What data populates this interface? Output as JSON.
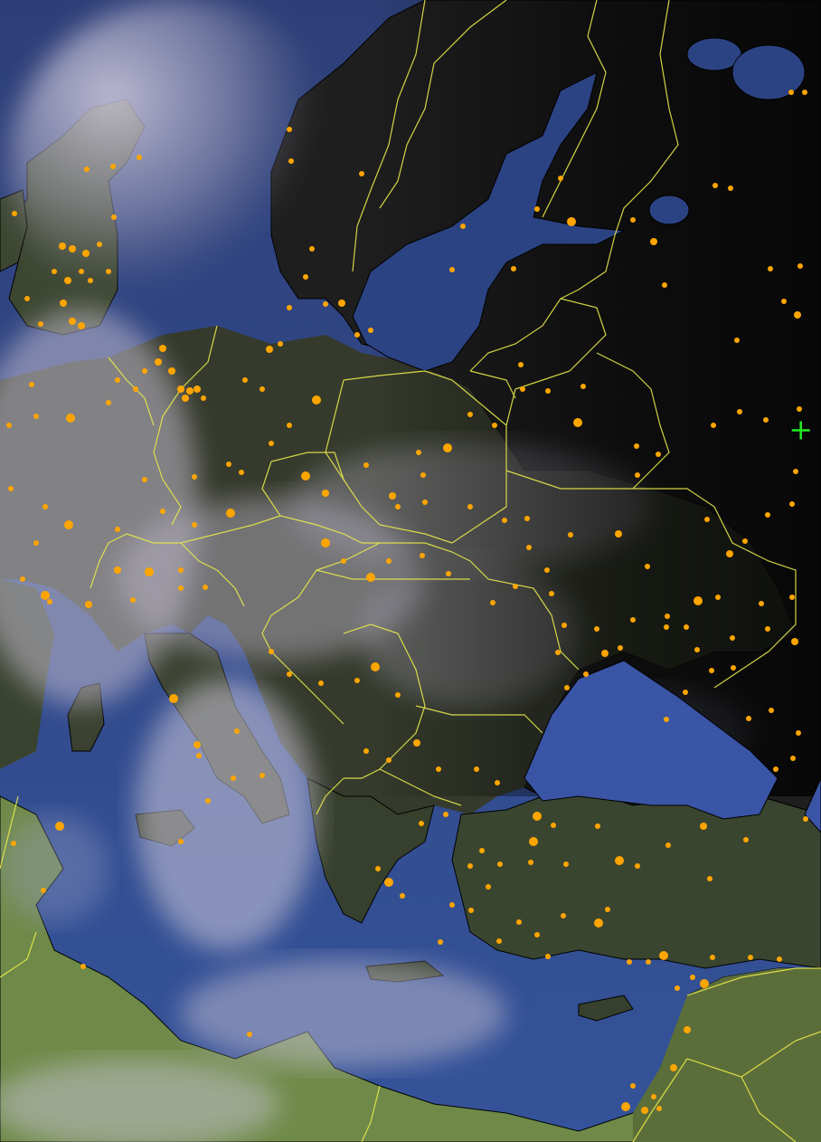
{
  "map": {
    "type": "satellite-composite",
    "region": "Europe",
    "projection": "equirectangular",
    "lon_range": [
      -7,
      50
    ],
    "lat_range": [
      29,
      72
    ],
    "has_borders": true,
    "has_coastlines": true,
    "has_city_markers": true,
    "has_labels": false
  },
  "colors": {
    "sea_day": "#2f4b8c",
    "sea_night": "#3b5ab0",
    "land_night": "#1c1c1c",
    "land_day": "#3d4a2a",
    "desert": "#7e9a52",
    "cloud": "#c9c4d6",
    "coastline": "#000000",
    "border": "#e8e84a",
    "city": "#ffa500",
    "marker": "#22ee22"
  },
  "marker": {
    "icon": "crosshair-icon",
    "lon": 48.6,
    "lat": 55.8
  }
}
